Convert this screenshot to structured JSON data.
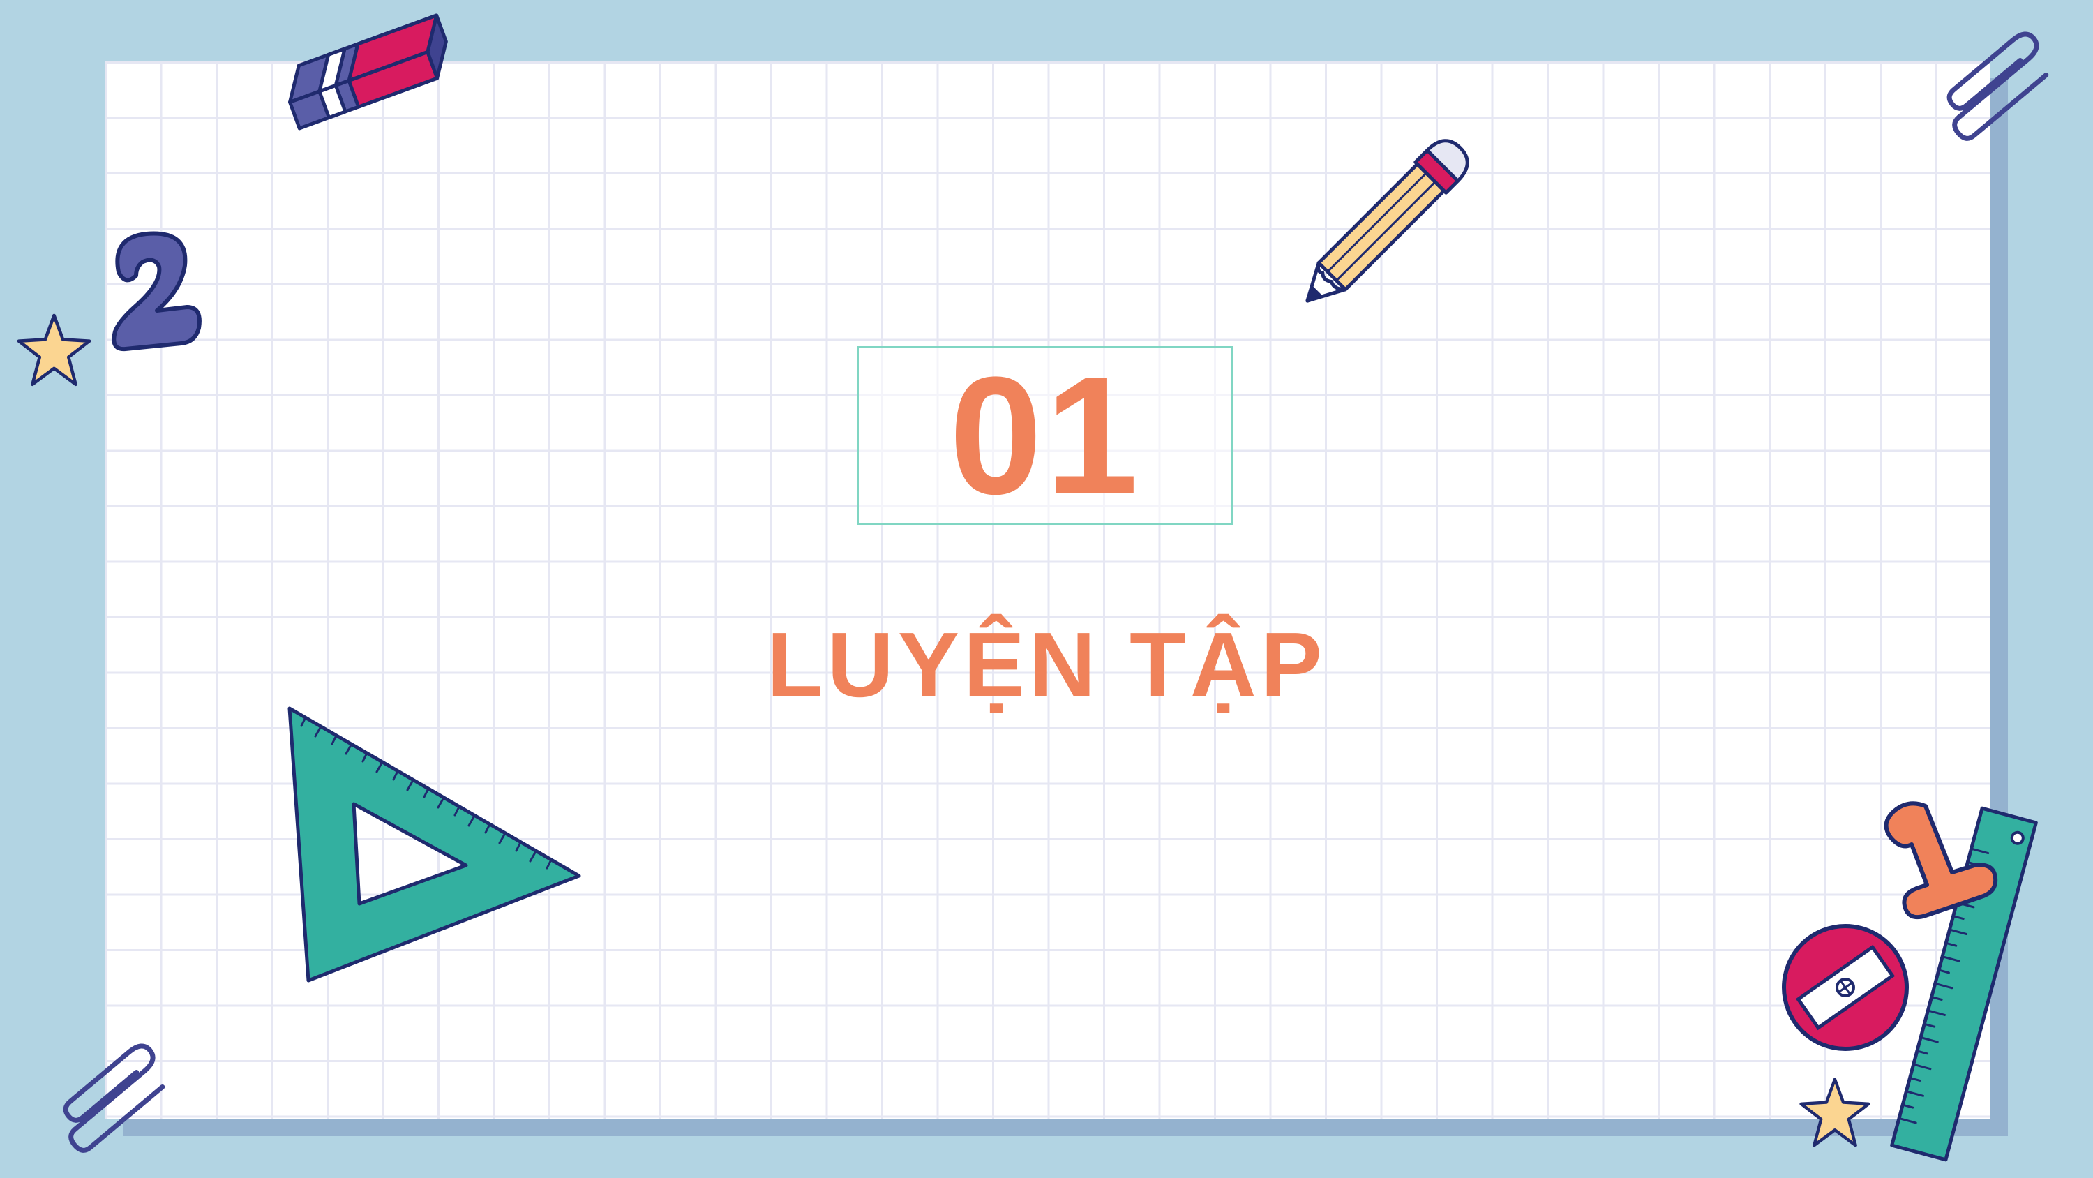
{
  "slide": {
    "number": "01",
    "title": "LUYỆN TẬP"
  },
  "colors": {
    "background": "#b2d4e3",
    "paper": "#ffffff",
    "grid_line": "#e6e7f3",
    "accent_orange": "#f0825a",
    "box_border": "#80d6c3",
    "teal": "#33b0a0",
    "navy": "#1f2a6e",
    "magenta": "#d81b5f",
    "indigo": "#5a5ea8",
    "star_yellow": "#fbd591"
  },
  "decorations": [
    "eraser-icon",
    "pencil-icon",
    "paperclip-icon",
    "number-two-icon",
    "star-icon",
    "set-square-icon",
    "number-one-icon",
    "ruler-icon",
    "sharpener-icon"
  ]
}
